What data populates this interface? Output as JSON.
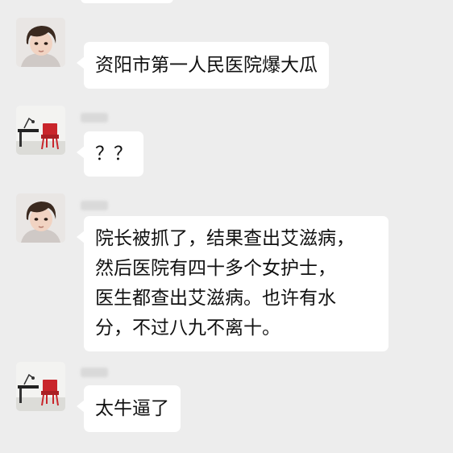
{
  "chat": {
    "messages": [
      {
        "sender": "girl",
        "text": "资阳市第一人民医院爆大瓜"
      },
      {
        "sender": "chair",
        "text": "？？"
      },
      {
        "sender": "girl",
        "text": "院长被抓了，结果查出艾滋病，\n然后医院有四十多个女护士，\n医生都查出艾滋病。也许有水\n分，不过八九不离十。"
      },
      {
        "sender": "chair",
        "text": "太牛逼了"
      }
    ]
  },
  "avatars": {
    "girl": {
      "icon": "child-portrait-icon"
    },
    "chair": {
      "icon": "red-chair-desk-icon",
      "accent": "#c9252b"
    }
  }
}
